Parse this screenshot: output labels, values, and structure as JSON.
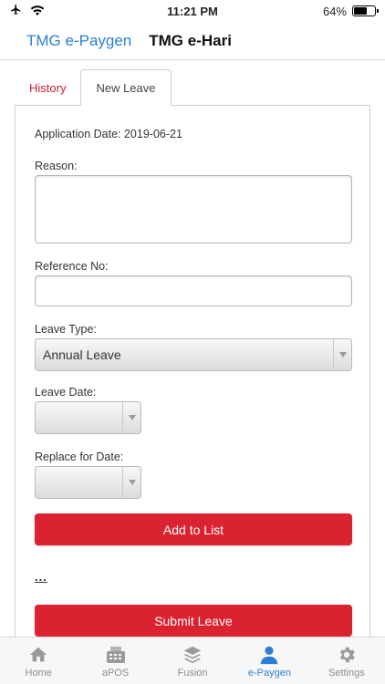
{
  "status_bar": {
    "time": "11:21 PM",
    "battery": "64%",
    "battery_level": 0.64
  },
  "header": {
    "link": "TMG e-Paygen",
    "title": "TMG e-Hari"
  },
  "tabs": [
    {
      "label": "History"
    },
    {
      "label": "New Leave"
    }
  ],
  "form": {
    "application_date": "Application Date: 2019-06-21",
    "reason_label": "Reason:",
    "reference_label": "Reference No:",
    "leave_type_label": "Leave Type:",
    "leave_type_value": "Annual Leave",
    "leave_date_label": "Leave Date:",
    "replace_date_label": "Replace for Date:",
    "add_button": "Add to List",
    "ellipsis": "...",
    "submit_button": "Submit Leave"
  },
  "bottom_nav": [
    {
      "label": "Home",
      "icon": "home-icon"
    },
    {
      "label": "aPOS",
      "icon": "register-icon"
    },
    {
      "label": "Fusion",
      "icon": "layers-icon"
    },
    {
      "label": "e-Paygen",
      "icon": "person-icon"
    },
    {
      "label": "Settings",
      "icon": "gear-icon"
    }
  ],
  "colors": {
    "accent": "#2a7fd4",
    "primary_button": "#db2230",
    "history_tab": "#d0202e",
    "inactive_nav": "#8c8c8c"
  }
}
